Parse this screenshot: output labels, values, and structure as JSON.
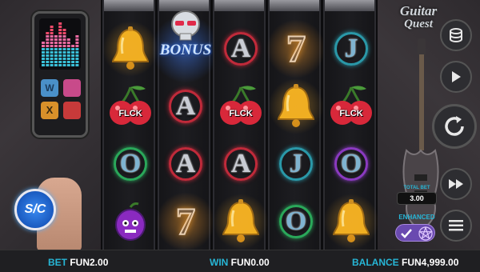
{
  "game": {
    "logo_line1": "Guitar",
    "logo_line2": "Quest",
    "bonus_label": "BONUS"
  },
  "reels": [
    [
      "bell",
      "cherry",
      "circle-green",
      "plum"
    ],
    [
      "bonus-skull",
      "A",
      "A",
      "seven"
    ],
    [
      "A",
      "cherry",
      "A",
      "bell"
    ],
    [
      "seven",
      "bell",
      "J",
      "O"
    ],
    [
      "J",
      "cherry",
      "O",
      "bell"
    ]
  ],
  "symbols": {
    "cherry_text": "FLCK",
    "letter_a": "A",
    "letter_j": "J",
    "letter_o": "O",
    "seven": "7"
  },
  "side_panel": {
    "total_bet_label": "TOTAL BET",
    "total_bet_value": "3.00",
    "enhanced_label": "ENHANCED"
  },
  "sc_badge": "S/C",
  "bottom_bar": {
    "bet_label": "BET",
    "bet_value": "FUN2.00",
    "win_label": "WIN",
    "win_value": "FUN0.00",
    "balance_label": "BALANCE",
    "balance_value": "FUN4,999.00"
  },
  "colors": {
    "accent_cyan": "#27b6d6",
    "gold": "#f0b020",
    "bonus_blue": "#3a7cf0"
  },
  "icons": [
    "coins-stack-icon",
    "play-icon",
    "spin-refresh-icon",
    "fast-forward-icon",
    "menu-icon",
    "pentagram-icon"
  ]
}
